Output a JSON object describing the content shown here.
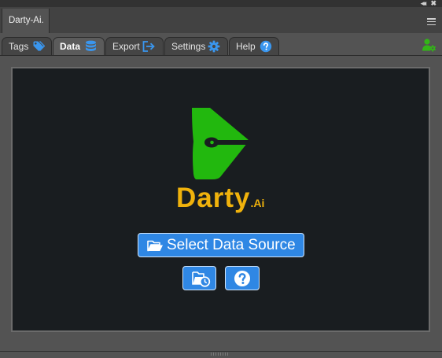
{
  "panel": {
    "title": "Darty-Ai."
  },
  "window_controls": {
    "collapse_glyph": "◂◂",
    "close_glyph": "✖"
  },
  "tabs": [
    {
      "label": "Tags",
      "icon": "tag-icon",
      "active": false
    },
    {
      "label": "Data",
      "icon": "database-icon",
      "active": true
    },
    {
      "label": "Export",
      "icon": "export-icon",
      "active": false
    },
    {
      "label": "Settings",
      "icon": "gear-icon",
      "active": false
    },
    {
      "label": "Help",
      "icon": "question-circle-icon",
      "active": false
    }
  ],
  "toolbar": {
    "user_settings_icon": "user-gear-icon"
  },
  "logo": {
    "word": "Darty",
    "suffix": ".Ai"
  },
  "actions": {
    "select_source_label": "Select Data Source",
    "select_source_icon": "folder-open-icon",
    "recent_icon": "folder-clock-icon",
    "help_icon": "question-circle-icon"
  },
  "colors": {
    "accent_blue": "#2f87e4",
    "tab_icon_blue": "#3a96ee",
    "logo_green": "#22b80e",
    "logo_gold": "#f0b20c",
    "user_icon_green": "#33b518",
    "content_bg": "#191d20",
    "panel_bg": "#535353"
  }
}
